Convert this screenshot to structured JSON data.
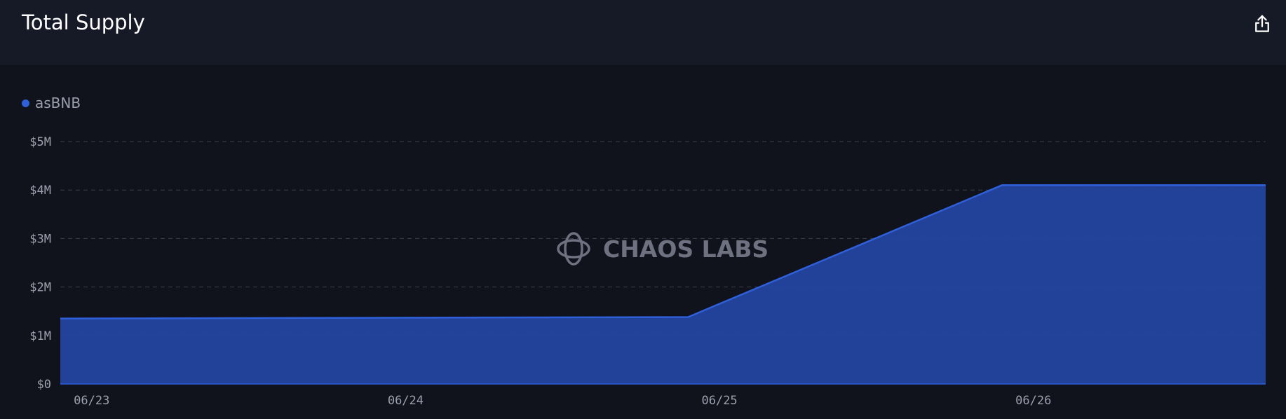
{
  "header": {
    "title": "Total Supply",
    "export_icon": "share-upload-icon"
  },
  "watermark": {
    "text": "CHAOS LABS",
    "icon": "chaos-labs-logo-icon"
  },
  "colors": {
    "background": "#11131c",
    "header_background": "#161a26",
    "series": "#2f5fd9",
    "area_fill": "#2346a3",
    "grid": "#3a3f4c"
  },
  "chart_data": {
    "type": "area",
    "title": "Total Supply",
    "xlabel": "",
    "ylabel": "",
    "x_tick_labels": [
      "06/23",
      "06/24",
      "06/25",
      "06/26"
    ],
    "y_tick_labels": [
      "$0",
      "$1M",
      "$2M",
      "$3M",
      "$4M",
      "$5M"
    ],
    "y_ticks": [
      0,
      1000000,
      2000000,
      3000000,
      4000000,
      5000000
    ],
    "ylim": [
      0,
      5000000
    ],
    "xlim": [
      -0.1,
      3.74
    ],
    "grid": true,
    "legend_position": "top-left",
    "series": [
      {
        "name": "asBNB",
        "x": [
          -0.1,
          1.9,
          2.9,
          3.74
        ],
        "values": [
          1350000,
          1380000,
          4100000,
          4100000
        ]
      }
    ]
  }
}
